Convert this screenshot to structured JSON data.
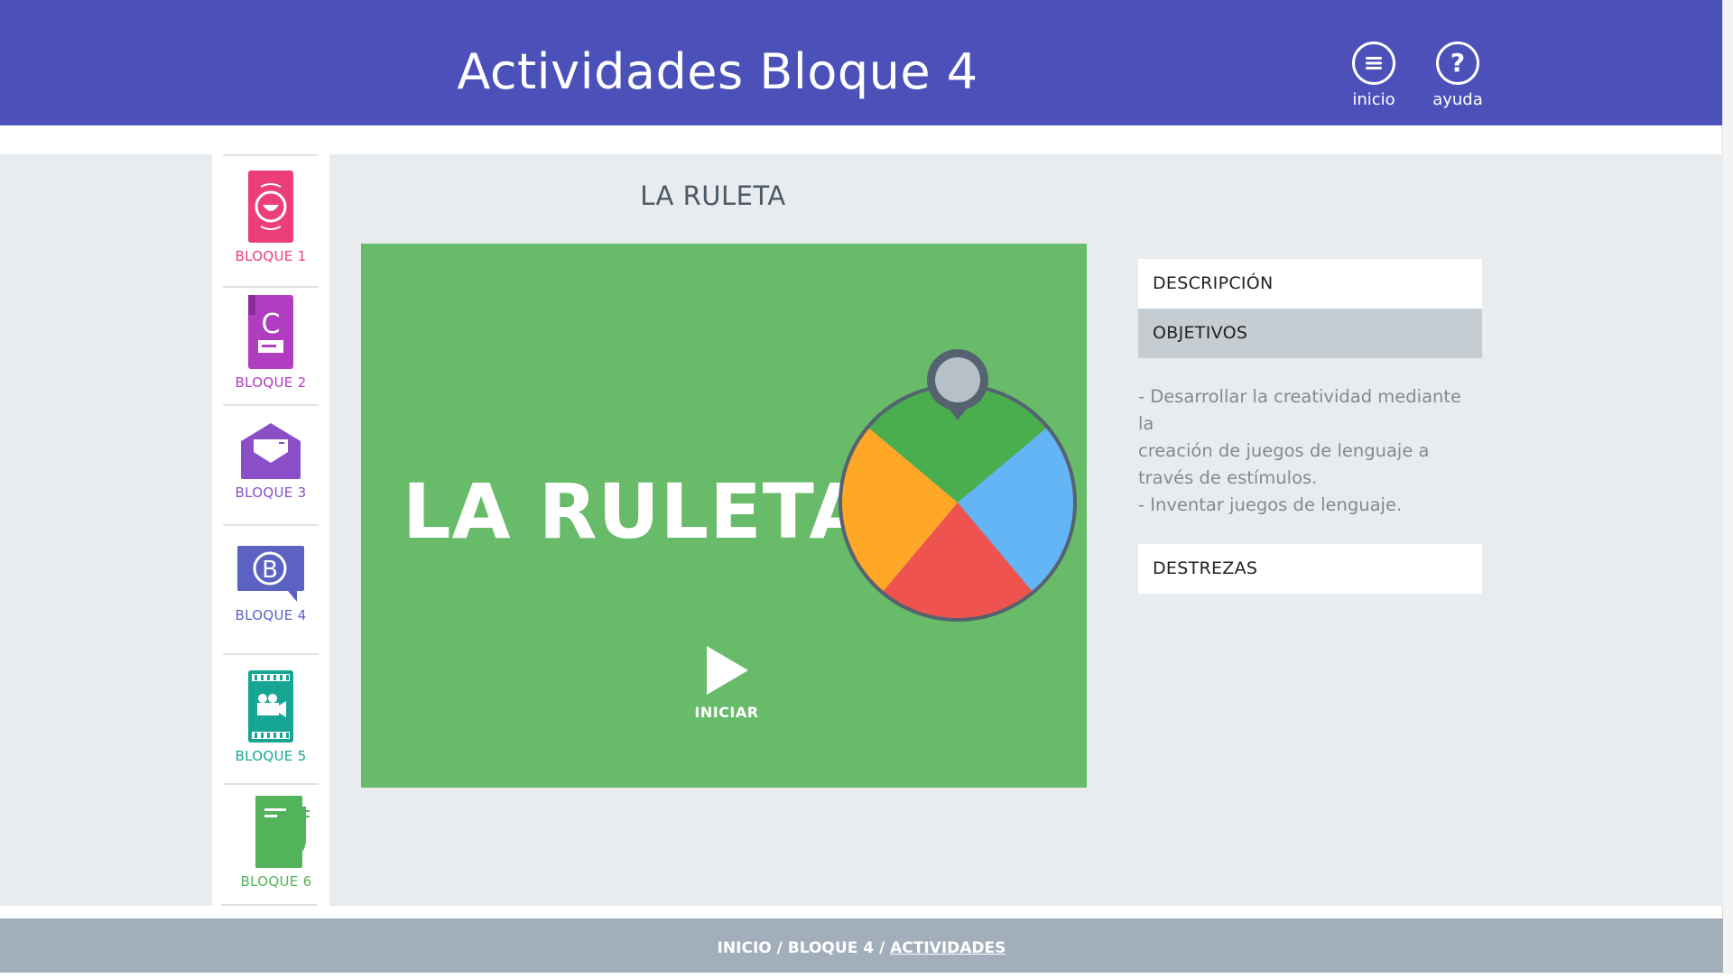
{
  "header": {
    "title": "Actividades Bloque 4",
    "inicio_label": "inicio",
    "ayuda_label": "ayuda"
  },
  "sidebar": {
    "items": [
      {
        "label": "BLOQUE 1",
        "color": "#ec3e7a",
        "icon": "phone-smile-icon"
      },
      {
        "label": "BLOQUE 2",
        "color": "#b03dbf",
        "icon": "book-c-icon"
      },
      {
        "label": "BLOQUE 3",
        "color": "#8a4fc7",
        "icon": "envelope-icon"
      },
      {
        "label": "BLOQUE 4",
        "color": "#5b62c2",
        "icon": "chat-b-icon"
      },
      {
        "label": "BLOQUE 5",
        "color": "#17a594",
        "icon": "film-camera-icon"
      },
      {
        "label": "BLOQUE 6",
        "color": "#53b35a",
        "icon": "notebook-pen-icon"
      }
    ]
  },
  "activity": {
    "title": "LA RULETA",
    "card_title": "LA RULETA",
    "play_label": "INICIAR",
    "card_color": "#68bb69"
  },
  "panel": {
    "description_tab": "DESCRIPCIÓN",
    "objectives_tab": "OBJETIVOS",
    "objectives": [
      "- Desarrollar la creatividad mediante la",
      "creación de juegos de lenguaje a",
      "través de estímulos.",
      "- Inventar juegos de lenguaje."
    ],
    "skills_tab": "DESTREZAS"
  },
  "footer": {
    "crumb_1": "INICIO",
    "sep_1": " / ",
    "crumb_2": "BLOQUE 4",
    "sep_2": " / ",
    "crumb_3": "ACTIVIDADES"
  },
  "colors": {
    "header_bg": "#4b51b8",
    "main_bg": "#e9ecef",
    "footer_bg": "#a2afbb"
  }
}
